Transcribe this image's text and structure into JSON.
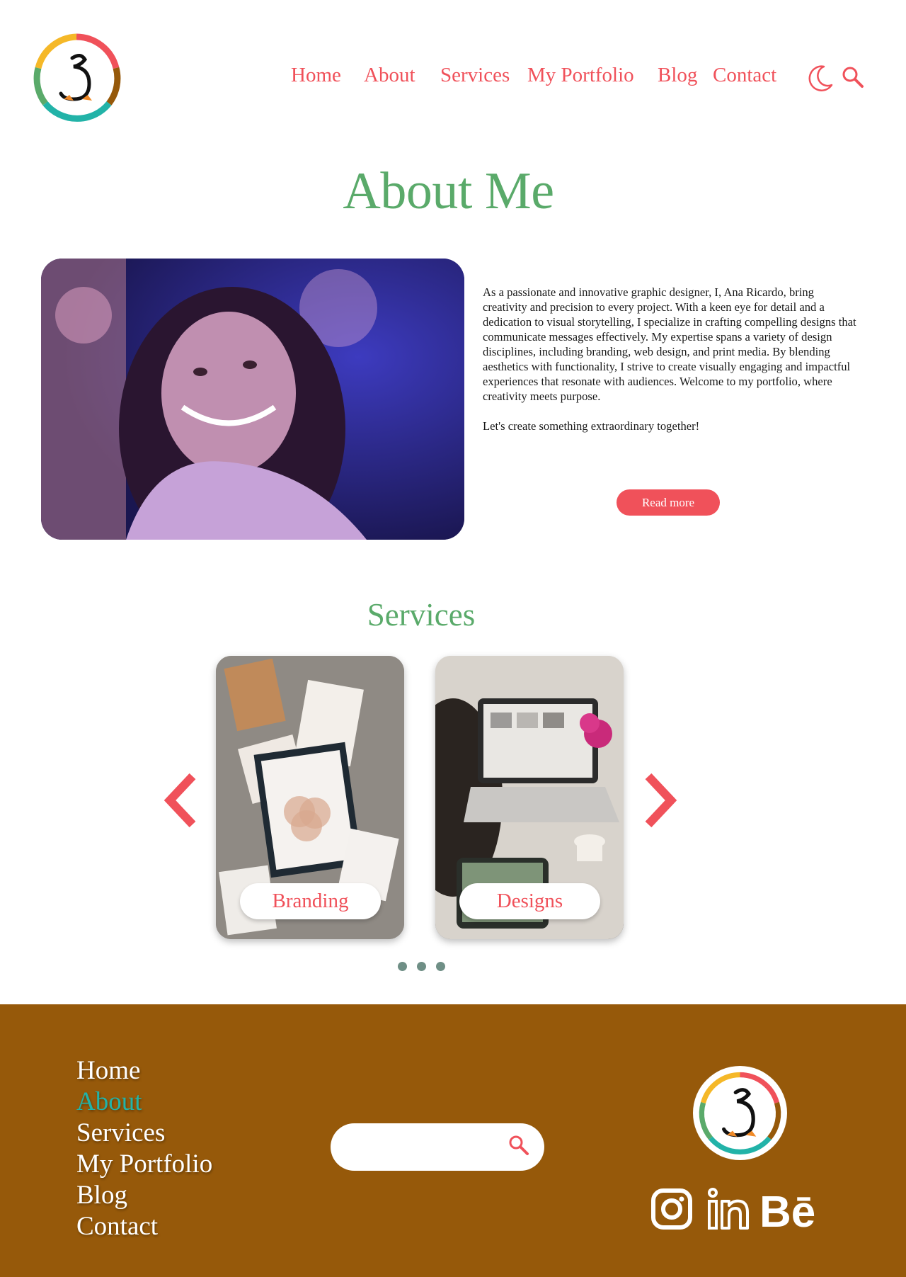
{
  "header": {
    "nav": [
      {
        "label": "Home"
      },
      {
        "label": "About"
      },
      {
        "label": "Services"
      },
      {
        "label": "My Portfolio"
      },
      {
        "label": "Blog"
      },
      {
        "label": "Contact"
      }
    ],
    "icons": [
      "moon-icon",
      "search-icon"
    ]
  },
  "about": {
    "title": "About Me",
    "paragraph1": "As a passionate and innovative graphic designer, I, Ana Ricardo, bring creativity and precision to every project. With a keen eye for detail and a dedication to visual storytelling, I specialize in crafting compelling designs that communicate messages effectively. My expertise spans a variety of design disciplines, including branding, web design, and print media. By blending aesthetics with functionality, I strive to create visually engaging and impactful experiences that resonate with audiences. Welcome to my portfolio, where creativity meets purpose.",
    "paragraph2": "Let's create something extraordinary together!",
    "read_more": "Read more"
  },
  "services": {
    "title": "Services",
    "cards": [
      {
        "label": "Branding"
      },
      {
        "label": "Designs"
      }
    ],
    "dots": 3
  },
  "footer": {
    "nav": [
      {
        "label": "Home",
        "active": false
      },
      {
        "label": "About",
        "active": true
      },
      {
        "label": "Services",
        "active": false
      },
      {
        "label": "My Portfolio",
        "active": false
      },
      {
        "label": "Blog",
        "active": false
      },
      {
        "label": "Contact",
        "active": false
      }
    ],
    "search_placeholder": "",
    "social": [
      "instagram-icon",
      "linkedin-icon",
      "behance-icon"
    ]
  },
  "colors": {
    "accent": "#f0515a",
    "heading": "#5aaa6a",
    "footer_bg": "#96590a",
    "footer_active": "#22b3a8"
  }
}
